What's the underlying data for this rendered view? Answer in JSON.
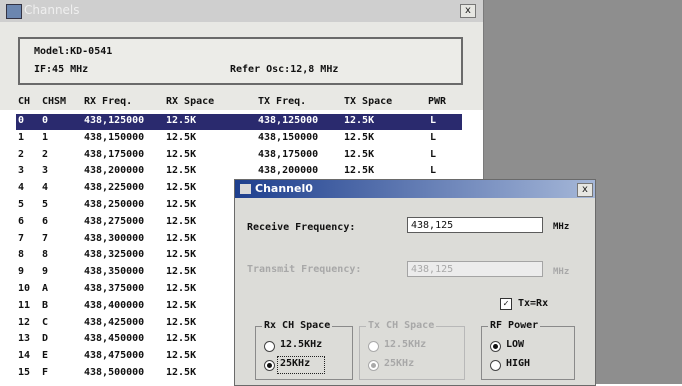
{
  "main_window": {
    "title": "Channels",
    "close": "x",
    "model": "Model:KD-0541",
    "if": "IF:45 MHz",
    "refer": "Refer Osc:12,8 MHz"
  },
  "table": {
    "headers": [
      "CH",
      "CHSM",
      "RX Freq.",
      "RX Space",
      "TX Freq.",
      "TX Space",
      "PWR"
    ],
    "rows": [
      [
        "0",
        "0",
        "438,125000",
        "12.5K",
        "438,125000",
        "12.5K",
        "L"
      ],
      [
        "1",
        "1",
        "438,150000",
        "12.5K",
        "438,150000",
        "12.5K",
        "L"
      ],
      [
        "2",
        "2",
        "438,175000",
        "12.5K",
        "438,175000",
        "12.5K",
        "L"
      ],
      [
        "3",
        "3",
        "438,200000",
        "12.5K",
        "438,200000",
        "12.5K",
        "L"
      ],
      [
        "4",
        "4",
        "438,225000",
        "12.5K",
        "",
        "",
        ""
      ],
      [
        "5",
        "5",
        "438,250000",
        "12.5K",
        "",
        "",
        ""
      ],
      [
        "6",
        "6",
        "438,275000",
        "12.5K",
        "",
        "",
        ""
      ],
      [
        "7",
        "7",
        "438,300000",
        "12.5K",
        "",
        "",
        ""
      ],
      [
        "8",
        "8",
        "438,325000",
        "12.5K",
        "",
        "",
        ""
      ],
      [
        "9",
        "9",
        "438,350000",
        "12.5K",
        "",
        "",
        ""
      ],
      [
        "10",
        "A",
        "438,375000",
        "12.5K",
        "",
        "",
        ""
      ],
      [
        "11",
        "B",
        "438,400000",
        "12.5K",
        "",
        "",
        ""
      ],
      [
        "12",
        "C",
        "438,425000",
        "12.5K",
        "",
        "",
        ""
      ],
      [
        "13",
        "D",
        "438,450000",
        "12.5K",
        "",
        "",
        ""
      ],
      [
        "14",
        "E",
        "438,475000",
        "12.5K",
        "",
        "",
        ""
      ],
      [
        "15",
        "F",
        "438,500000",
        "12.5K",
        "",
        "",
        ""
      ]
    ],
    "selected_row": 0
  },
  "dialog": {
    "title": "Channel0",
    "close": "x",
    "rx_label": "Receive Frequency:",
    "rx_value": "438,125",
    "rx_unit": "MHz",
    "tx_label": "Transmit Frequency:",
    "tx_value": "438,125",
    "tx_unit": "MHz",
    "tx_eq_rx_label": "Tx=Rx",
    "tx_eq_rx_check": "✓",
    "rx_space_group": "Rx CH Space",
    "rx_space_opt1": "12.5KHz",
    "rx_space_opt2": "25KHz",
    "tx_space_group": "Tx CH Space",
    "tx_space_opt1": "12.5KHz",
    "tx_space_opt2": "25KHz",
    "rf_group": "RF Power",
    "rf_opt1": "LOW",
    "rf_opt2": "HIGH"
  },
  "colors": {
    "selection": "#2a2a6e",
    "dialog_title_start": "#1e3f8e",
    "desktop": "#8e8e8e"
  }
}
